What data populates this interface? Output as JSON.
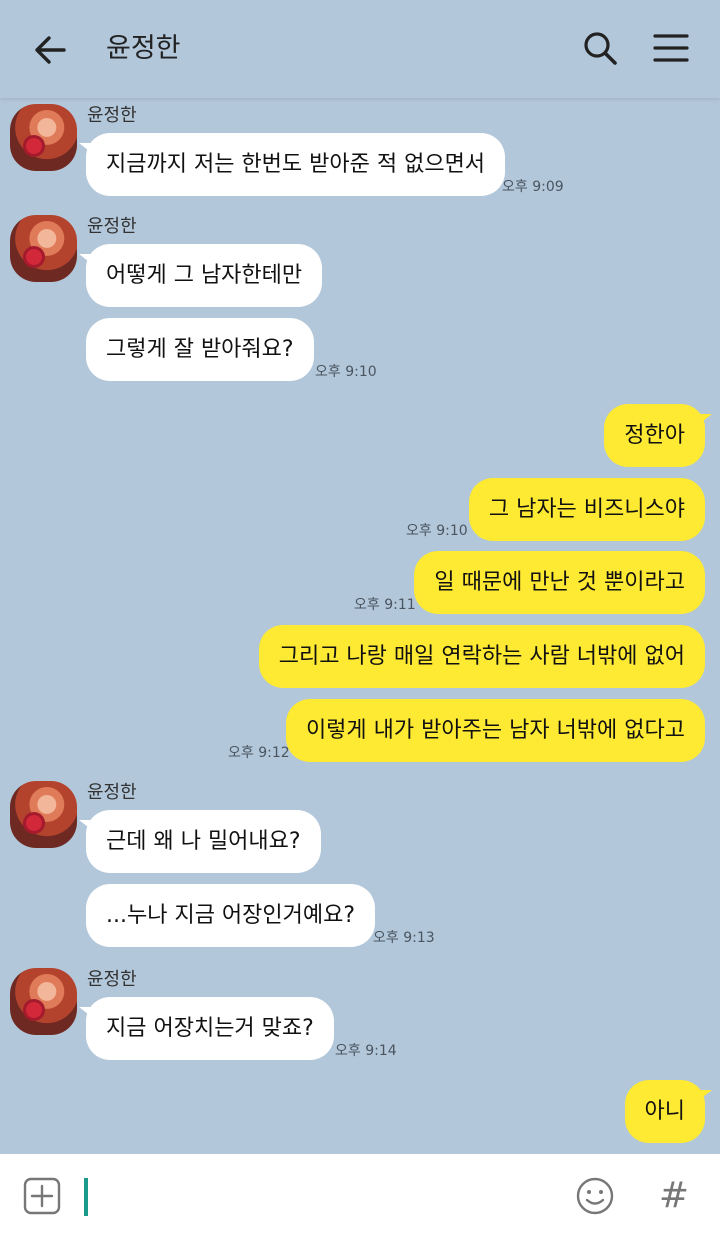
{
  "header": {
    "title": "윤정한",
    "back_icon": "arrow-left-icon",
    "search_icon": "search-icon",
    "menu_icon": "hamburger-menu-icon"
  },
  "colors": {
    "background": "#b2c7da",
    "incoming_bubble": "#ffffff",
    "outgoing_bubble": "#fee933",
    "composer_caret": "#1a9a8a"
  },
  "messages": [
    {
      "sender": "윤정한",
      "text": "지금까지 저는 한번도 받아준 적 없으면서",
      "time": "오후 9:09"
    },
    {
      "sender": "윤정한",
      "text": "어떻게 그 남자한테만"
    },
    {
      "text": "그렇게 잘 받아줘요?",
      "time": "오후 9:10"
    },
    {
      "text": "정한아"
    },
    {
      "text": "그 남자는 비즈니스야",
      "time": "오후 9:10"
    },
    {
      "text": "일 때문에 만난 것 뿐이라고",
      "time": "오후 9:11"
    },
    {
      "text": "그리고 나랑 매일 연락하는 사람 너밖에 없어"
    },
    {
      "text": "이렇게 내가 받아주는 남자 너밖에 없다고",
      "time": "오후 9:12"
    },
    {
      "sender": "윤정한",
      "text": "근데 왜 나 밀어내요?"
    },
    {
      "text": "...누나 지금 어장인거예요?",
      "time": "오후 9:13"
    },
    {
      "sender": "윤정한",
      "text": "지금 어장치는거 맞죠?",
      "time": "오후 9:14"
    },
    {
      "text": "아니"
    }
  ],
  "composer": {
    "plus_icon": "plus-square-icon",
    "emoji_icon": "emoji-icon",
    "hash_label": "#"
  }
}
